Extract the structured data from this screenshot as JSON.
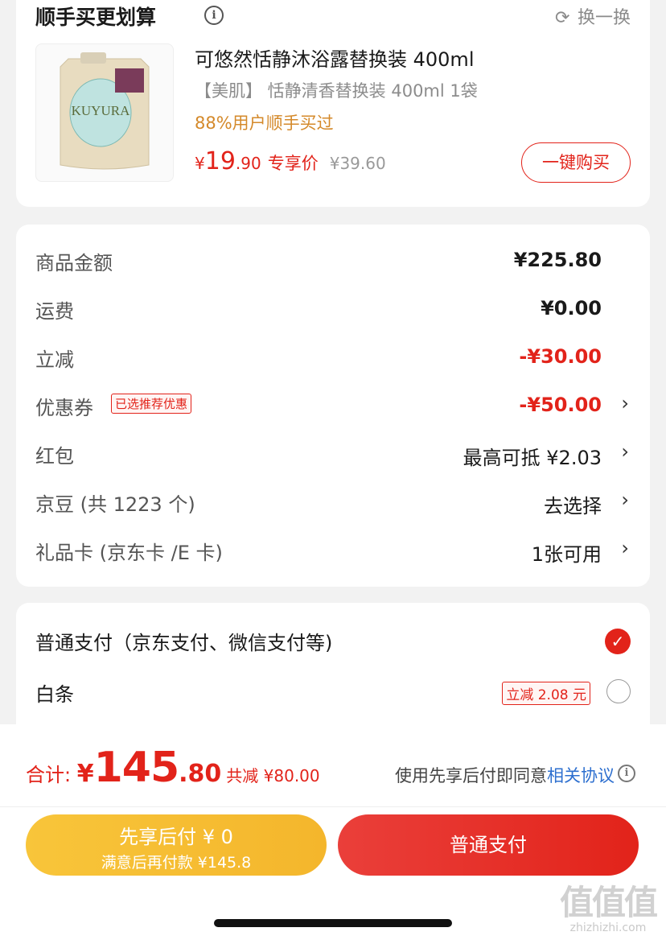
{
  "deal": {
    "title": "顺手买更划算",
    "info_icon": "ⓘ",
    "swap_label": "换一换",
    "swap_icon": "⟳",
    "product": {
      "name": "可悠然恬静沐浴露替换装 400ml",
      "spec": "【美肌】 恬静清香替换装 400ml 1袋",
      "social_proof": "88%用户顺手买过",
      "image_text": "KUYURA",
      "price_yen": "¥",
      "price_int": "19",
      "price_dec": ".90",
      "price_tag": "专享价",
      "original_price": "¥39.60",
      "buy_label": "一键购买"
    }
  },
  "summary": {
    "rows": [
      {
        "label": "商品金额",
        "value": "¥225.80"
      },
      {
        "label": "运费",
        "value": "¥0.00"
      },
      {
        "label": "立减",
        "value": "-¥30.00"
      },
      {
        "label": "优惠券",
        "badge": "已选推荐优惠",
        "value": "-¥50.00"
      },
      {
        "label": "红包",
        "value": "最高可抵 ¥2.03"
      },
      {
        "label": "京豆 (共 1223 个)",
        "value": "去选择"
      },
      {
        "label": "礼品卡 (京东卡 /E 卡)",
        "value": "1张可用"
      }
    ],
    "chevron": "›"
  },
  "payment": {
    "option1": "普通支付（京东支付、微信支付等)",
    "option1_checked": true,
    "check_glyph": "✓",
    "option2": "白条",
    "option2_badge": "立减 2.08 元",
    "option2_checked": false
  },
  "bottom": {
    "total_label": "合计: ",
    "total_yen": "¥",
    "total_int": "145",
    "total_dec": ".80",
    "total_discount": "共减 ¥80.00",
    "agree_text": "使用先享后付即同意",
    "agree_link": "相关协议",
    "agree_icon": "i",
    "btn_later_line1": "先享后付 ¥ 0",
    "btn_later_line2": "满意后再付款 ¥145.8",
    "btn_pay": "普通支付"
  },
  "watermark": {
    "big": "值值值",
    "small": "zhizhizhi.com"
  },
  "colors": {
    "accent": "#e2231a",
    "yellow": "#f4b62c",
    "orange_text": "#d4892a",
    "link": "#2d6fcf"
  }
}
